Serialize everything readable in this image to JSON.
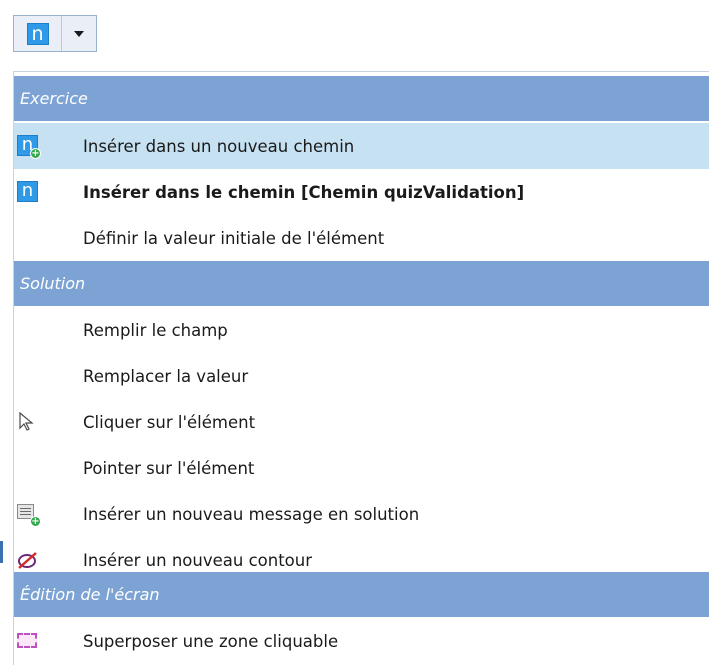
{
  "toolbar": {
    "split_button_icon_letter": "n",
    "dropdown_arrow": "▼"
  },
  "menu": {
    "sections": [
      {
        "header": "Exercice",
        "items": [
          {
            "label": "Insérer dans un nouveau chemin",
            "icon": "n-plus-icon",
            "highlighted": true,
            "bold": false
          },
          {
            "label": "Insérer dans le chemin [Chemin quizValidation]",
            "icon": "n-icon",
            "highlighted": false,
            "bold": true
          },
          {
            "label": "Définir la valeur initiale de l'élément",
            "icon": "",
            "highlighted": false,
            "bold": false
          }
        ]
      },
      {
        "header": "Solution",
        "items": [
          {
            "label": "Remplir le champ",
            "icon": ""
          },
          {
            "label": "Remplacer la valeur",
            "icon": ""
          },
          {
            "label": "Cliquer sur l'élément",
            "icon": "cursor-arrow-icon"
          },
          {
            "label": "Pointer sur l'élément",
            "icon": ""
          },
          {
            "label": "Insérer un nouveau message en solution",
            "icon": "message-plus-icon"
          },
          {
            "label": "Insérer un nouveau contour",
            "icon": "contour-no-icon"
          }
        ]
      },
      {
        "header": "Édition de l'écran",
        "items": [
          {
            "label": "Superposer une zone cliquable",
            "icon": "clickable-zone-icon"
          }
        ]
      }
    ]
  },
  "colors": {
    "header_bg": "#7da3d4",
    "highlight_bg": "#c6e1f2",
    "n_icon_blue": "#2f9be8",
    "plus_badge_green": "#2fa94a"
  }
}
